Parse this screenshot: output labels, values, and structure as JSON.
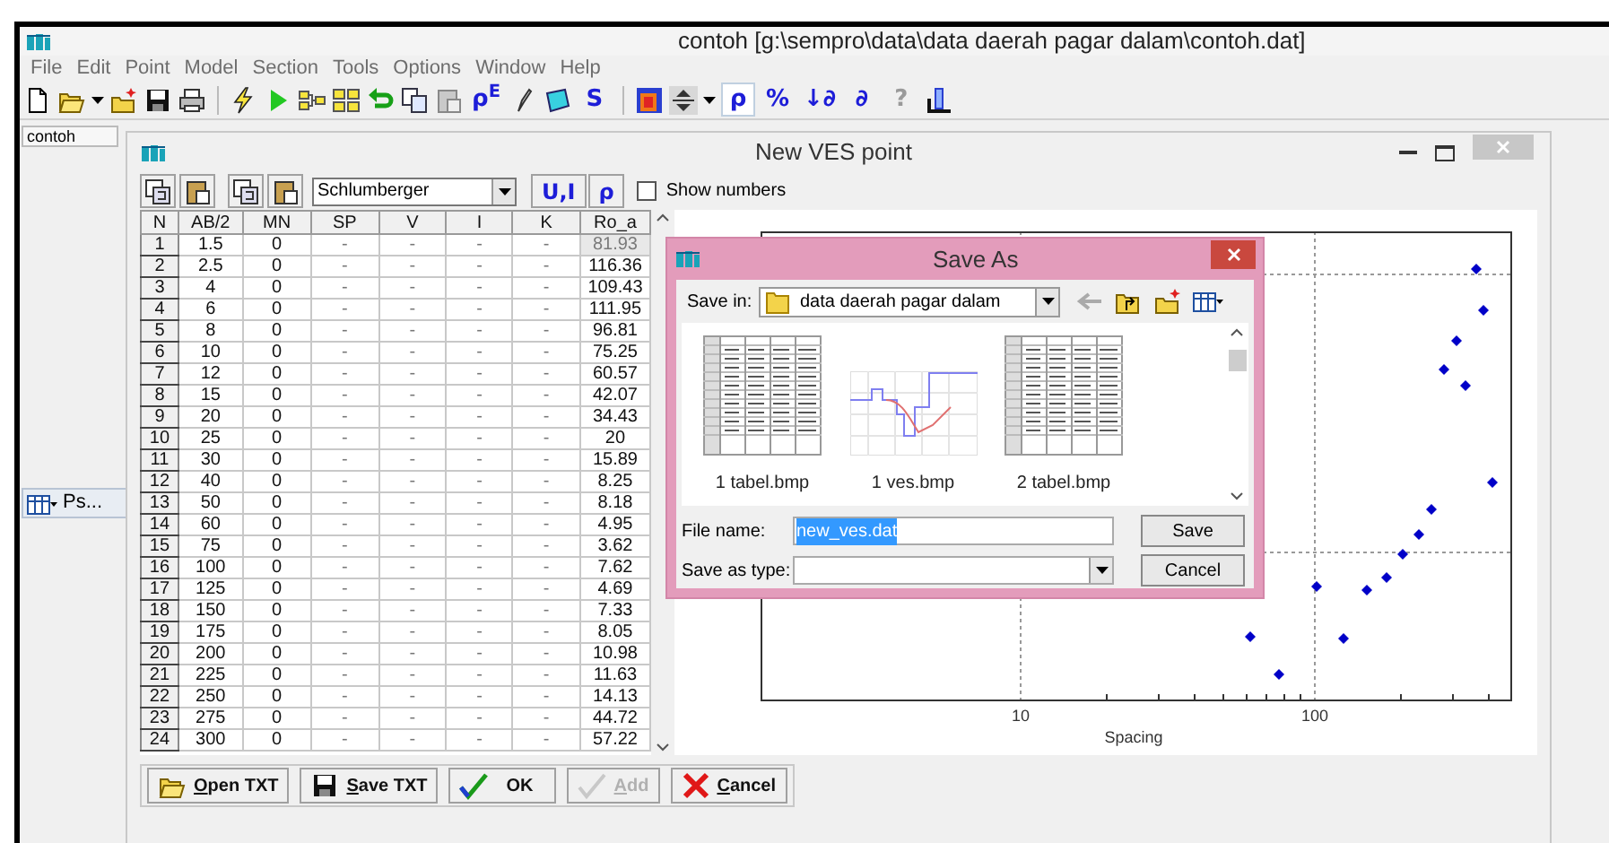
{
  "window": {
    "title": "contoh [g:\\sempro\\data\\data daerah pagar dalam\\contoh.dat]"
  },
  "menu": [
    "File",
    "Edit",
    "Point",
    "Model",
    "Section",
    "Tools",
    "Options",
    "Window",
    "Help"
  ],
  "toolbar_glyphs": [
    {
      "text": "ρ$^{E}$",
      "pressed": false,
      "disabled": false
    },
    {
      "text": "S",
      "pressed": false,
      "disabled": false
    },
    {
      "text": "ρ",
      "pressed": true,
      "disabled": false
    },
    {
      "text": "%",
      "pressed": false,
      "disabled": false
    },
    {
      "text": "↓∂",
      "pressed": false,
      "disabled": false
    },
    {
      "text": "∂",
      "pressed": false,
      "disabled": false
    },
    {
      "text": "?",
      "pressed": false,
      "disabled": true
    }
  ],
  "document_tab": "contoh",
  "minimized_window": {
    "title": "Ps..."
  },
  "ves_window": {
    "title": "New VES point",
    "array_type": "Schlumberger",
    "buttons": [
      "U,I",
      "ρ"
    ],
    "show_numbers": {
      "label": "Show numbers",
      "checked": false
    },
    "table": {
      "columns": [
        "N",
        "AB/2",
        "MN",
        "SP",
        "V",
        "I",
        "K",
        "Ro_a"
      ],
      "rows": [
        {
          "cells": [
            "1",
            "1.5",
            "0",
            "-",
            "-",
            "-",
            "-",
            "81.93"
          ],
          "selected": true
        },
        {
          "cells": [
            "2",
            "2.5",
            "0",
            "-",
            "-",
            "-",
            "-",
            "116.36"
          ],
          "selected": false
        },
        {
          "cells": [
            "3",
            "4",
            "0",
            "-",
            "-",
            "-",
            "-",
            "109.43"
          ],
          "selected": false
        },
        {
          "cells": [
            "4",
            "6",
            "0",
            "-",
            "-",
            "-",
            "-",
            "111.95"
          ],
          "selected": false
        },
        {
          "cells": [
            "5",
            "8",
            "0",
            "-",
            "-",
            "-",
            "-",
            "96.81"
          ],
          "selected": false
        },
        {
          "cells": [
            "6",
            "10",
            "0",
            "-",
            "-",
            "-",
            "-",
            "75.25"
          ],
          "selected": false
        },
        {
          "cells": [
            "7",
            "12",
            "0",
            "-",
            "-",
            "-",
            "-",
            "60.57"
          ],
          "selected": false
        },
        {
          "cells": [
            "8",
            "15",
            "0",
            "-",
            "-",
            "-",
            "-",
            "42.07"
          ],
          "selected": false
        },
        {
          "cells": [
            "9",
            "20",
            "0",
            "-",
            "-",
            "-",
            "-",
            "34.43"
          ],
          "selected": false
        },
        {
          "cells": [
            "10",
            "25",
            "0",
            "-",
            "-",
            "-",
            "-",
            "20"
          ],
          "selected": false
        },
        {
          "cells": [
            "11",
            "30",
            "0",
            "-",
            "-",
            "-",
            "-",
            "15.89"
          ],
          "selected": false
        },
        {
          "cells": [
            "12",
            "40",
            "0",
            "-",
            "-",
            "-",
            "-",
            "8.25"
          ],
          "selected": false
        },
        {
          "cells": [
            "13",
            "50",
            "0",
            "-",
            "-",
            "-",
            "-",
            "8.18"
          ],
          "selected": false
        },
        {
          "cells": [
            "14",
            "60",
            "0",
            "-",
            "-",
            "-",
            "-",
            "4.95"
          ],
          "selected": false
        },
        {
          "cells": [
            "15",
            "75",
            "0",
            "-",
            "-",
            "-",
            "-",
            "3.62"
          ],
          "selected": false
        },
        {
          "cells": [
            "16",
            "100",
            "0",
            "-",
            "-",
            "-",
            "-",
            "7.62"
          ],
          "selected": false
        },
        {
          "cells": [
            "17",
            "125",
            "0",
            "-",
            "-",
            "-",
            "-",
            "4.69"
          ],
          "selected": false
        },
        {
          "cells": [
            "18",
            "150",
            "0",
            "-",
            "-",
            "-",
            "-",
            "7.33"
          ],
          "selected": false
        },
        {
          "cells": [
            "19",
            "175",
            "0",
            "-",
            "-",
            "-",
            "-",
            "8.05"
          ],
          "selected": false
        },
        {
          "cells": [
            "20",
            "200",
            "0",
            "-",
            "-",
            "-",
            "-",
            "10.98"
          ],
          "selected": false
        },
        {
          "cells": [
            "21",
            "225",
            "0",
            "-",
            "-",
            "-",
            "-",
            "11.63"
          ],
          "selected": false
        },
        {
          "cells": [
            "22",
            "250",
            "0",
            "-",
            "-",
            "-",
            "-",
            "14.13"
          ],
          "selected": false
        },
        {
          "cells": [
            "23",
            "275",
            "0",
            "-",
            "-",
            "-",
            "-",
            "44.72"
          ],
          "selected": false
        },
        {
          "cells": [
            "24",
            "300",
            "0",
            "-",
            "-",
            "-",
            "-",
            "57.22"
          ],
          "selected": false
        }
      ]
    },
    "chart": {
      "xtick_labels": [
        "10",
        "100"
      ],
      "xlabel": "Spacing"
    },
    "actions": [
      {
        "kind": "open",
        "label": "Open TXT",
        "mnemonic": true,
        "disabled": false
      },
      {
        "kind": "save",
        "label": "Save TXT",
        "mnemonic": true,
        "disabled": false
      },
      {
        "kind": "ok",
        "label": "OK",
        "mnemonic": false,
        "disabled": false
      },
      {
        "kind": "add",
        "label": "Add",
        "mnemonic": true,
        "disabled": true
      },
      {
        "kind": "cancel",
        "label": "Cancel",
        "mnemonic": true,
        "disabled": false
      }
    ]
  },
  "save_dialog": {
    "title": "Save As",
    "save_in_label": "Save in:",
    "folder": "data daerah pagar dalam",
    "files": [
      {
        "kind": "table",
        "name": "1 tabel.bmp"
      },
      {
        "kind": "graph",
        "name": "1 ves.bmp"
      },
      {
        "kind": "table",
        "name": "2 tabel.bmp"
      }
    ],
    "file_name_label": "File name:",
    "file_name": {
      "value": "new_ves.dat",
      "selected": true
    },
    "type_label": "Save as type:",
    "buttons": [
      "Save",
      "Cancel"
    ]
  }
}
